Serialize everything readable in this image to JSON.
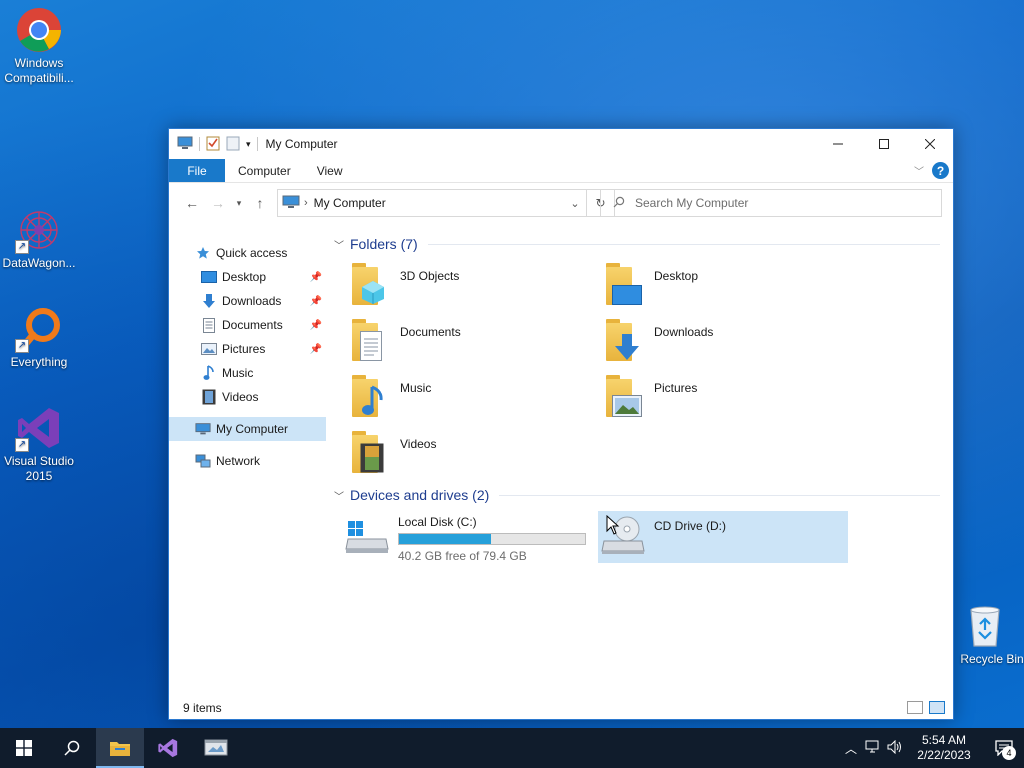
{
  "desktop": {
    "icons": [
      {
        "label": "Windows Compatibili..."
      },
      {
        "label": "DataWagon..."
      },
      {
        "label": "Everything"
      },
      {
        "label": "Visual Studio 2015"
      },
      {
        "label": "Recycle Bin"
      }
    ]
  },
  "window": {
    "title": "My Computer",
    "ribbon_tabs": [
      "File",
      "Computer",
      "View"
    ],
    "help_label": "?",
    "address": {
      "current": "My Computer"
    },
    "search": {
      "placeholder": "Search My Computer"
    },
    "sidebar": {
      "quick_access": "Quick access",
      "pinned": [
        {
          "label": "Desktop"
        },
        {
          "label": "Downloads"
        },
        {
          "label": "Documents"
        },
        {
          "label": "Pictures"
        }
      ],
      "unpinned": [
        {
          "label": "Music"
        },
        {
          "label": "Videos"
        }
      ],
      "my_computer": "My Computer",
      "network": "Network"
    },
    "folders_group": {
      "title": "Folders (7)"
    },
    "folders": [
      {
        "label": "3D Objects"
      },
      {
        "label": "Desktop"
      },
      {
        "label": "Documents"
      },
      {
        "label": "Downloads"
      },
      {
        "label": "Music"
      },
      {
        "label": "Pictures"
      },
      {
        "label": "Videos"
      }
    ],
    "drives_group": {
      "title": "Devices and drives (2)"
    },
    "drives": [
      {
        "label": "Local Disk (C:)",
        "free_text": "40.2 GB free of 79.4 GB",
        "used_fraction": 0.494
      },
      {
        "label": "CD Drive (D:)"
      }
    ],
    "status": {
      "items": "9 items"
    }
  },
  "taskbar": {
    "clock_time": "5:54 AM",
    "clock_date": "2/22/2023",
    "notification_count": "4"
  },
  "colors": {
    "accent": "#1979ca",
    "selection": "#cce4f7",
    "drive_bar": "#26a0da",
    "group_header": "#1e3d8f"
  }
}
